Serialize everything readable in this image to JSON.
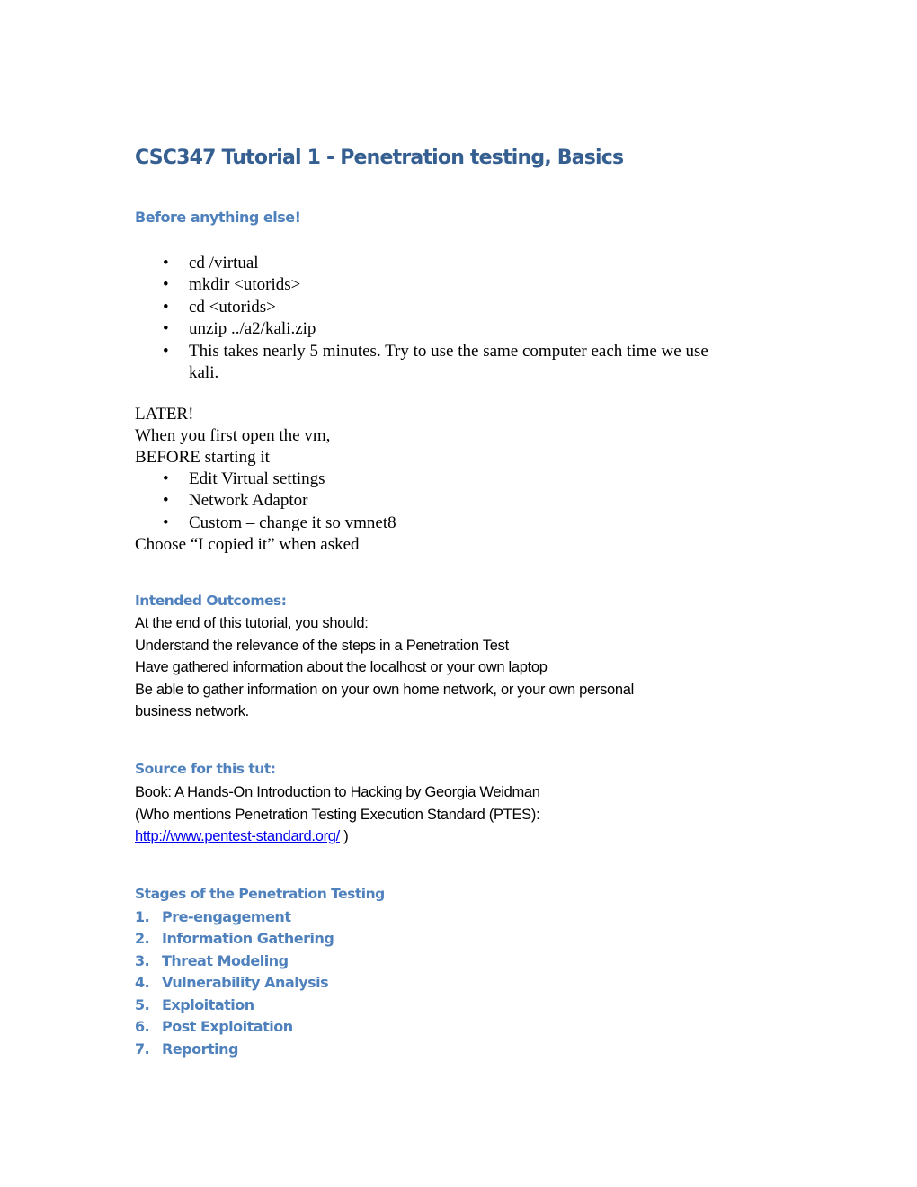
{
  "document": {
    "title": "CSC347 Tutorial 1 - Penetration testing, Basics",
    "before_section": {
      "heading": "Before anything else!",
      "bullets": [
        "cd /virtual",
        "mkdir <utorids>",
        "cd <utorids>",
        "unzip ../a2/kali.zip",
        "This takes nearly 5 minutes.  Try to use the same computer each time we use",
        "kali."
      ],
      "bullet_glyph": "•"
    },
    "later_section": {
      "lines": [
        "LATER!",
        "When you first open the vm,",
        "BEFORE starting it"
      ],
      "bullets": [
        "Edit Virtual settings",
        "Network Adaptor",
        "Custom – change it so vmnet8"
      ],
      "closing": "Choose “I copied it” when asked"
    },
    "outcomes_section": {
      "heading": "Intended Outcomes:",
      "lines": [
        "At the end of this tutorial, you should:",
        "Understand the relevance of the steps in a Penetration Test",
        "Have gathered information about the localhost or your own laptop",
        "Be able to gather information on your own home network, or your own personal",
        "business network."
      ]
    },
    "source_section": {
      "heading": "Source for this tut:",
      "book_line": "Book:   A Hands-On Introduction to Hacking by Georgia Weidman",
      "ptes_line": "(Who mentions Penetration Testing Execution Standard (PTES):",
      "link_text": "http://www.pentest-standard.org/",
      "link_suffix": " )"
    },
    "stages_section": {
      "heading": "Stages of the Penetration Testing",
      "items": [
        {
          "num": "1.",
          "label": "Pre-engagement"
        },
        {
          "num": "2.",
          "label": "Information Gathering"
        },
        {
          "num": "3.",
          "label": "Threat Modeling"
        },
        {
          "num": "4.",
          "label": "Vulnerability Analysis"
        },
        {
          "num": "5.",
          "label": "Exploitation"
        },
        {
          "num": "6.",
          "label": "Post Exploitation"
        },
        {
          "num": "7.",
          "label": "Reporting"
        }
      ]
    }
  },
  "colors": {
    "title": "#365f91",
    "heading": "#4f81bd",
    "body": "#000000",
    "link": "#0000ee"
  }
}
